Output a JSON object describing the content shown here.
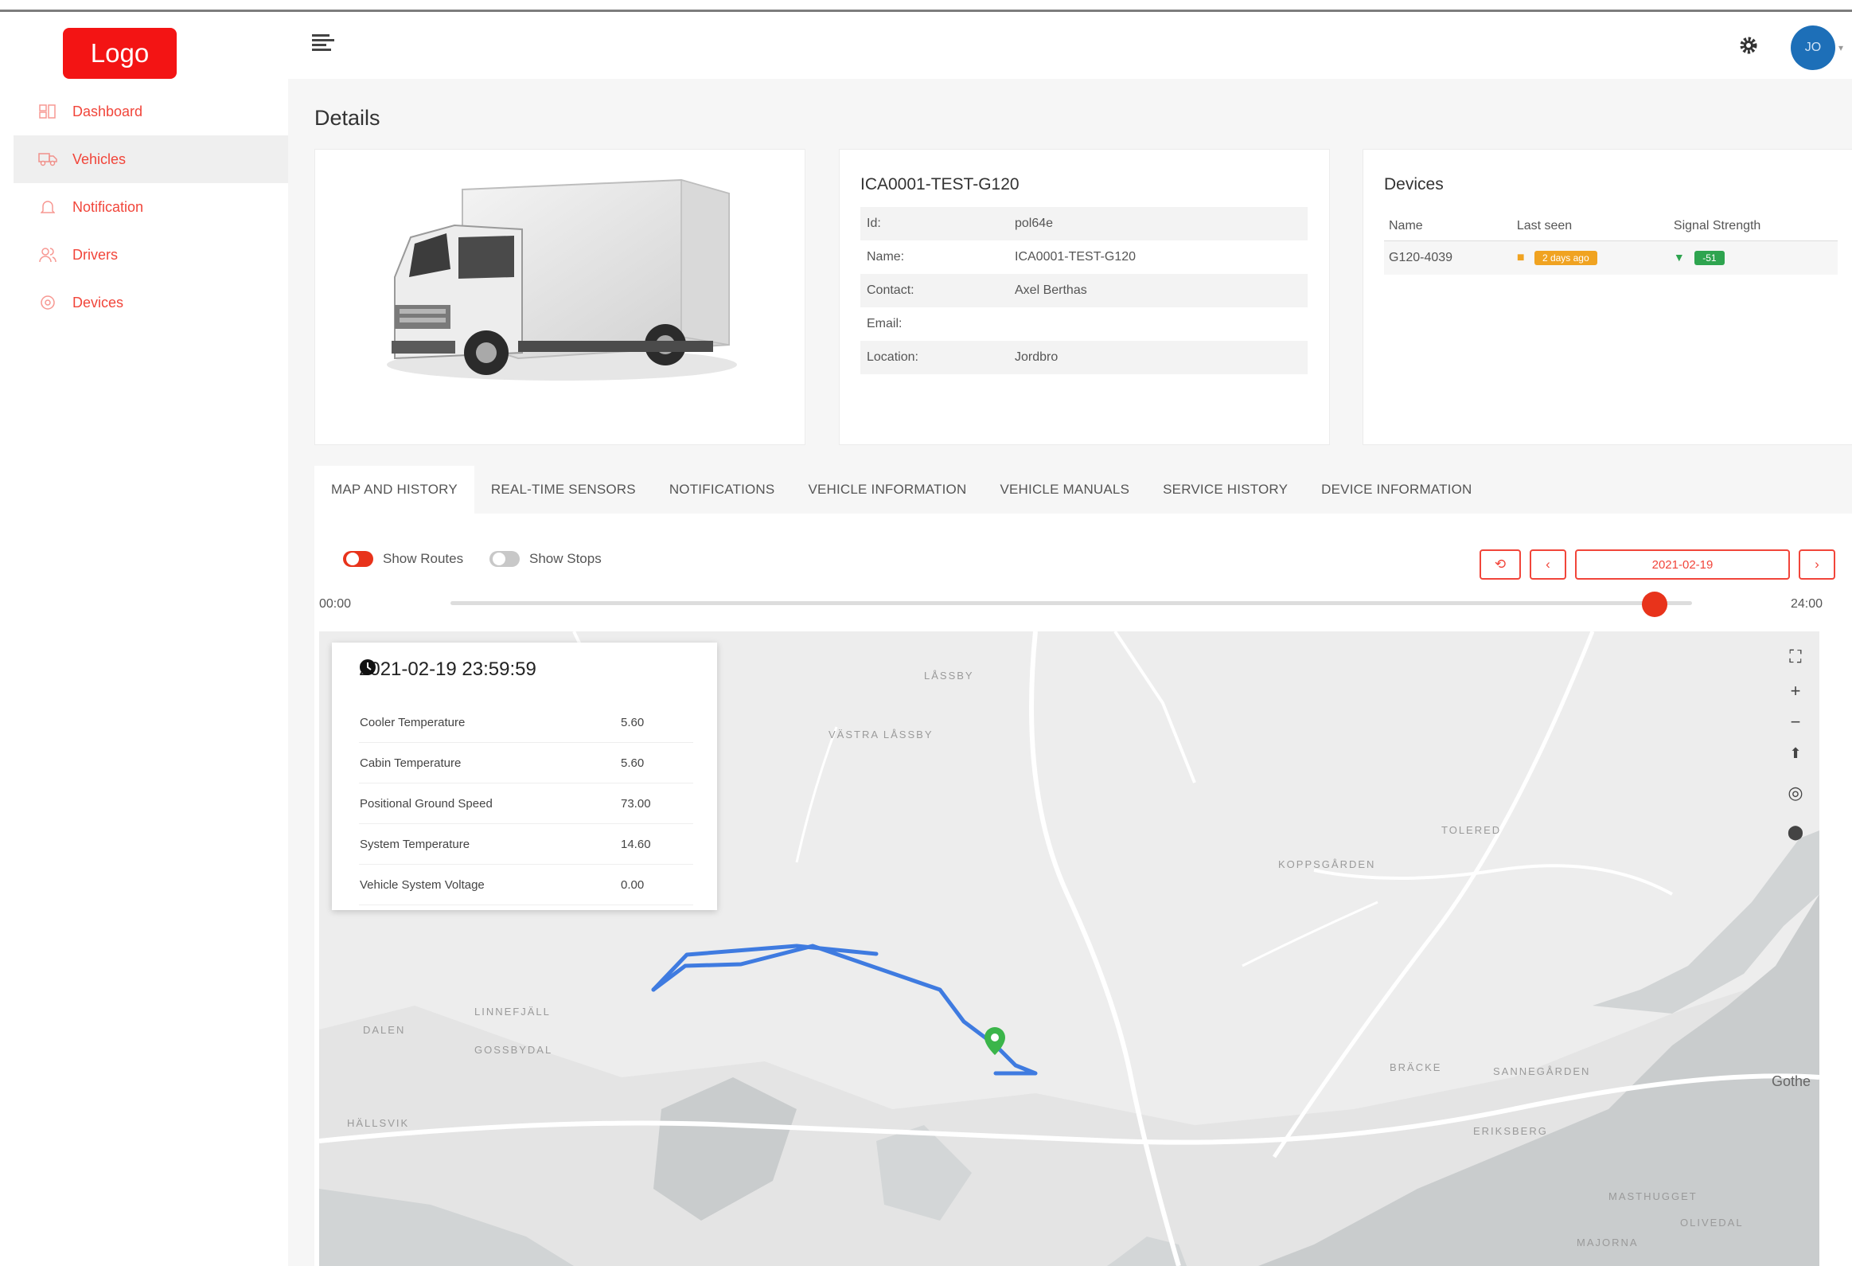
{
  "app": {
    "logo": "Logo",
    "user_initials": "JO"
  },
  "sidebar": {
    "items": [
      {
        "label": "Dashboard",
        "icon": "dashboard-icon"
      },
      {
        "label": "Vehicles",
        "icon": "truck-icon"
      },
      {
        "label": "Notification",
        "icon": "bell-icon"
      },
      {
        "label": "Drivers",
        "icon": "users-icon"
      },
      {
        "label": "Devices",
        "icon": "device-icon"
      }
    ]
  },
  "page": {
    "title": "Details"
  },
  "vehicle": {
    "title": "ICA0001-TEST-G120",
    "fields": [
      {
        "label": "Id:",
        "value": "pol64e"
      },
      {
        "label": "Name:",
        "value": "ICA0001-TEST-G120"
      },
      {
        "label": "Contact:",
        "value": "Axel Berthas"
      },
      {
        "label": "Email:",
        "value": ""
      },
      {
        "label": "Location:",
        "value": "Jordbro"
      }
    ]
  },
  "devices": {
    "title": "Devices",
    "headers": {
      "name": "Name",
      "last_seen": "Last seen",
      "signal": "Signal Strength"
    },
    "rows": [
      {
        "name": "G120-4039",
        "last_seen": "2 days ago",
        "signal": "-51"
      }
    ]
  },
  "tabs": [
    {
      "label": "MAP AND HISTORY"
    },
    {
      "label": "REAL-TIME SENSORS"
    },
    {
      "label": "NOTIFICATIONS"
    },
    {
      "label": "VEHICLE INFORMATION"
    },
    {
      "label": "VEHICLE MANUALS"
    },
    {
      "label": "SERVICE HISTORY"
    },
    {
      "label": "DEVICE INFORMATION"
    }
  ],
  "history": {
    "show_routes": "Show Routes",
    "show_stops": "Show Stops",
    "date": "2021-02-19",
    "time_start": "00:00",
    "time_end": "24:00",
    "slider_fraction": 0.97
  },
  "snapshot": {
    "timestamp": "2021-02-19 23:59:59",
    "sensors": [
      {
        "label": "Cooler Temperature",
        "value": "5.60"
      },
      {
        "label": "Cabin Temperature",
        "value": "5.60"
      },
      {
        "label": "Positional Ground Speed",
        "value": "73.00"
      },
      {
        "label": "System Temperature",
        "value": "14.60"
      },
      {
        "label": "Vehicle System Voltage",
        "value": "0.00"
      }
    ]
  },
  "map": {
    "labels": [
      "LÅSSBY",
      "VÄSTRA LÅSSBY",
      "LINNEFJÄLL",
      "DALEN",
      "GOSSBYDAL",
      "HÄLLSVIK",
      "TOLERED",
      "KOPPSGÅRDEN",
      "BRÄCKE",
      "SANNEGÅRDEN",
      "ERIKSBERG",
      "MASTHUGGET",
      "OLIVEDAL",
      "MAJORNA",
      "Gothe"
    ]
  },
  "colors": {
    "accent": "#f1453a",
    "route": "#3f7be0",
    "marker": "#3bb54a"
  }
}
